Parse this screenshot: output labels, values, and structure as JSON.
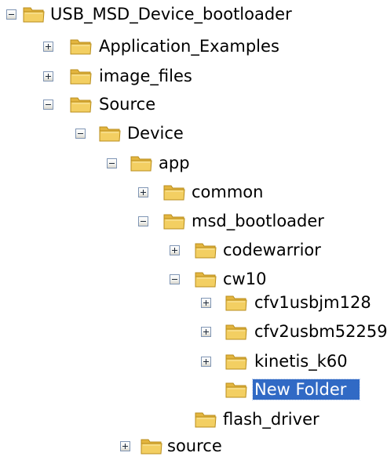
{
  "tree": {
    "nodes": [
      {
        "label": "USB_MSD_Device_bootloader",
        "expander": "expanded"
      },
      {
        "label": "Application_Examples",
        "expander": "collapsed"
      },
      {
        "label": "image_files",
        "expander": "collapsed"
      },
      {
        "label": "Source",
        "expander": "expanded"
      },
      {
        "label": "Device",
        "expander": "expanded"
      },
      {
        "label": "app",
        "expander": "expanded"
      },
      {
        "label": "common",
        "expander": "collapsed"
      },
      {
        "label": "msd_bootloader",
        "expander": "expanded"
      },
      {
        "label": "codewarrior",
        "expander": "collapsed"
      },
      {
        "label": "cw10",
        "expander": "expanded"
      },
      {
        "label": "cfv1usbjm128",
        "expander": "collapsed"
      },
      {
        "label": "cfv2usbm52259",
        "expander": "collapsed"
      },
      {
        "label": "kinetis_k60",
        "expander": "collapsed"
      },
      {
        "label": "New Folder",
        "expander": "none",
        "selected": true
      },
      {
        "label": "flash_driver",
        "expander": "none"
      },
      {
        "label": "source",
        "expander": "collapsed"
      }
    ]
  },
  "colors": {
    "selection": "#316ac5",
    "folder_body": "#f3cf62",
    "folder_outline": "#b88d1c"
  },
  "icons": {
    "expanded": "minus-expander-icon",
    "collapsed": "plus-expander-icon",
    "folder": "folder-icon"
  }
}
